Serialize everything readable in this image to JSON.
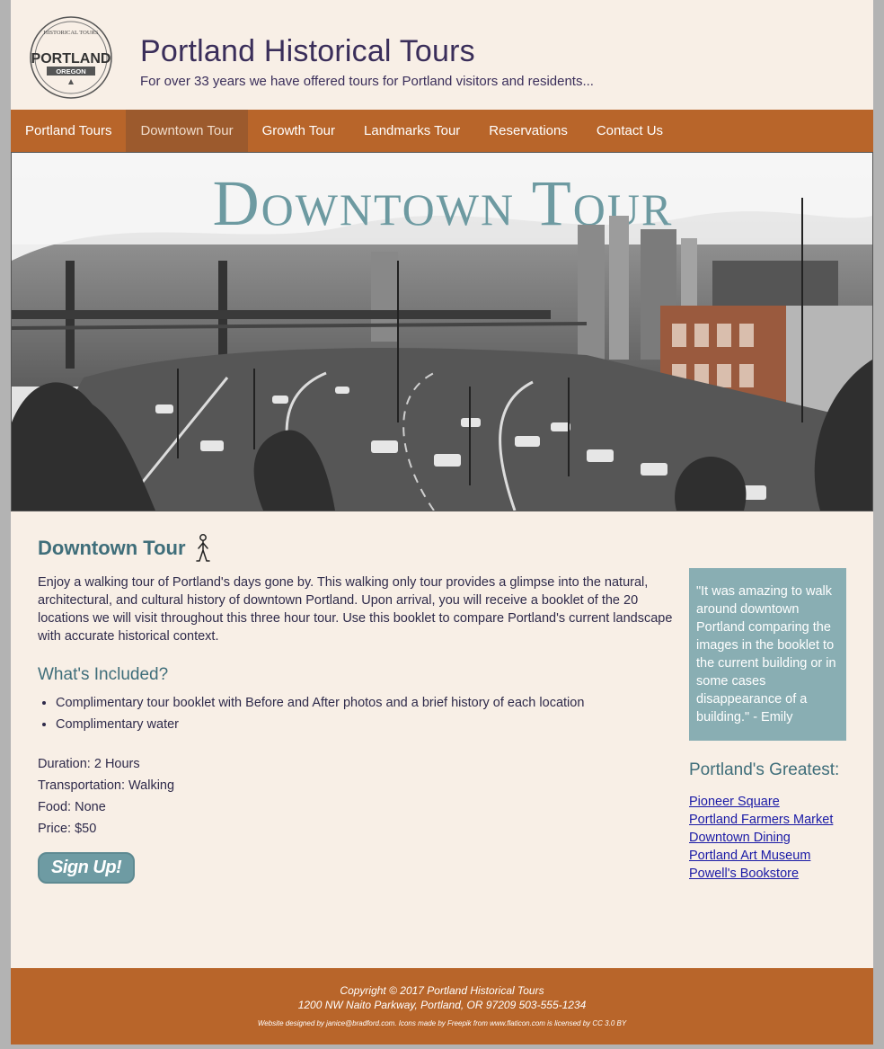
{
  "header": {
    "logo_top_text": "HISTORICAL TOURS",
    "logo_main_text": "PORTLAND",
    "logo_sub_text": "OREGON",
    "title": "Portland Historical Tours",
    "tagline": "For over 33 years we have offered tours for Portland visitors and residents..."
  },
  "nav": {
    "items": [
      {
        "label": "Portland Tours"
      },
      {
        "label": "Downtown Tour"
      },
      {
        "label": "Growth Tour"
      },
      {
        "label": "Landmarks Tour"
      },
      {
        "label": "Reservations"
      },
      {
        "label": "Contact Us"
      }
    ],
    "active_index": 1
  },
  "hero": {
    "banner_text": "Downtown Tour"
  },
  "main": {
    "title": "Downtown Tour",
    "title_icon": "walking-person-icon",
    "intro": "Enjoy a walking tour of Portland's days gone by. This walking only tour provides a glimpse into the natural, architectural, and cultural history of downtown Portland. Upon arrival, you will receive a booklet of the 20 locations we will visit throughout this three hour tour. Use this booklet to compare Portland's current landscape with accurate historical context.",
    "included_heading": "What's Included?",
    "included_items": [
      "Complimentary tour booklet with Before and After photos and a brief history of each location",
      "Complimentary water"
    ],
    "details": {
      "duration": "Duration: 2 Hours",
      "transportation": "Transportation: Walking",
      "food": "Food: None",
      "price": "Price: $50"
    },
    "signup_label": "Sign Up!"
  },
  "sidebar": {
    "quote": "\"It was amazing to walk around downtown Portland comparing the images in the booklet to the current building or in some cases disappearance of a building.\" - Emily",
    "greatest_heading": "Portland's Greatest:",
    "links": [
      "Pioneer Square",
      "Portland Farmers Market",
      "Downtown Dining",
      "Portland Art Museum",
      "Powell's Bookstore"
    ]
  },
  "footer": {
    "copyright": "Copyright © 2017   Portland Historical Tours",
    "address": "1200 NW Naito Parkway, Portland, OR 97209   503-555-1234",
    "credits": "Website designed by janice@bradford.com. Icons made by Freepik from www.flaticon.com is licensed by CC 3.0 BY"
  },
  "colors": {
    "accent": "#b8652a",
    "heading": "#3f6e7a",
    "quote_bg": "#89aeb3",
    "page_bg": "#f8efe6"
  }
}
